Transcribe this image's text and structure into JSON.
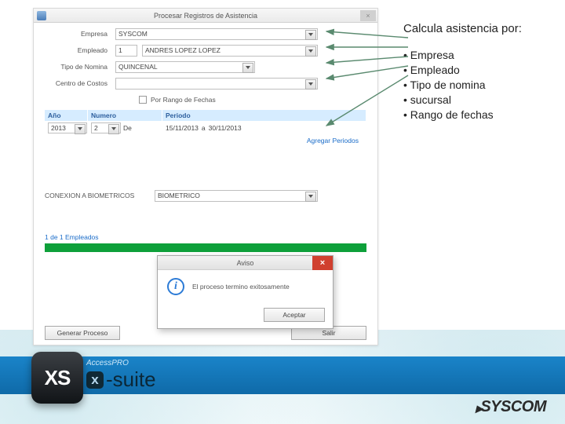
{
  "window": {
    "title": "Procesar Registros de Asistencia"
  },
  "form": {
    "empresa": {
      "label": "Empresa",
      "value": "SYSCOM"
    },
    "empleado": {
      "label": "Empleado",
      "id": "1",
      "name": "ANDRES LOPEZ LOPEZ"
    },
    "tipo_nomina": {
      "label": "Tipo de Nomina",
      "value": "QUINCENAL"
    },
    "centro_costos": {
      "label": "Centro de Costos",
      "value": ""
    },
    "rango_fechas_checkbox": "Por Rango de Fechas"
  },
  "periodo": {
    "headers": {
      "ano": "Año",
      "numero": "Numero",
      "periodo": "Periodo"
    },
    "row": {
      "ano": "2013",
      "numero": "2",
      "de": "De",
      "from": "15/11/2013",
      "a": "a",
      "to": "30/11/2013"
    },
    "agregar": "Agregar Periodos"
  },
  "conn": {
    "label": "CONEXION A BIOMETRICOS",
    "value": "BIOMETRICO"
  },
  "status": "1 de 1 Empleados",
  "buttons": {
    "generar": "Generar Proceso",
    "salir": "Salir"
  },
  "aviso": {
    "title": "Aviso",
    "msg": "El proceso termino exitosamente",
    "aceptar": "Aceptar"
  },
  "annotation": {
    "title": "Calcula asistencia por:",
    "items": [
      "Empresa",
      "Empleado",
      "Tipo de nomina",
      "sucursal",
      "Rango de fechas"
    ]
  },
  "branding": {
    "xs": "XS",
    "access": "AccessPRO",
    "suite": "-suite",
    "syscom": "SYSCOM"
  }
}
